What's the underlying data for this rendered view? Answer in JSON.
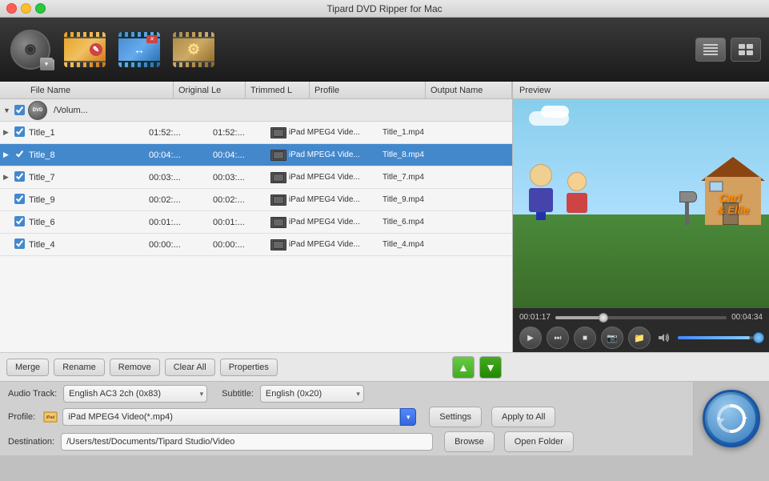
{
  "window": {
    "title": "Tipard DVD Ripper for Mac",
    "buttons": {
      "close": "close",
      "minimize": "minimize",
      "maximize": "maximize"
    }
  },
  "toolbar": {
    "dvd_label": "DVD",
    "view_list_icon": "≡",
    "view_grid_icon": "☰"
  },
  "file_list": {
    "headers": {
      "filename": "File Name",
      "original": "Original Le",
      "trimmed": "Trimmed L",
      "profile": "Profile",
      "output": "Output Name"
    },
    "root": {
      "path": "/Volum..."
    },
    "rows": [
      {
        "name": "Title_1",
        "original": "01:52:...",
        "trimmed": "01:52:...",
        "profile": "iPad MPEG4 Vide...",
        "output": "Title_1.mp4",
        "selected": false,
        "expanded": false
      },
      {
        "name": "Title_8",
        "original": "00:04:...",
        "trimmed": "00:04:...",
        "profile": "iPad MPEG4 Vide...",
        "output": "Title_8.mp4",
        "selected": true,
        "expanded": false
      },
      {
        "name": "Title_7",
        "original": "00:03:...",
        "trimmed": "00:03:...",
        "profile": "iPad MPEG4 Vide...",
        "output": "Title_7.mp4",
        "selected": false,
        "expanded": false
      },
      {
        "name": "Title_9",
        "original": "00:02:...",
        "trimmed": "00:02:...",
        "profile": "iPad MPEG4 Vide...",
        "output": "Title_9.mp4",
        "selected": false,
        "expanded": false
      },
      {
        "name": "Title_6",
        "original": "00:01:...",
        "trimmed": "00:01:...",
        "profile": "iPad MPEG4 Vide...",
        "output": "Title_6.mp4",
        "selected": false,
        "expanded": false
      },
      {
        "name": "Title_4",
        "original": "00:00:...",
        "trimmed": "00:00:...",
        "profile": "iPad MPEG4 Vide...",
        "output": "Title_4.mp4",
        "selected": false,
        "expanded": false
      }
    ]
  },
  "buttons": {
    "merge": "Merge",
    "rename": "Rename",
    "remove": "Remove",
    "clear_all": "Clear All",
    "properties": "Properties",
    "settings": "Settings",
    "apply_to_all": "Apply to All",
    "browse": "Browse",
    "open_folder": "Open Folder"
  },
  "preview": {
    "title": "Preview",
    "time_current": "00:01:17",
    "time_total": "00:04:34",
    "progress_pct": 28
  },
  "player_controls": {
    "play": "▶",
    "forward": "⏭",
    "stop": "■",
    "screenshot": "📷",
    "folder": "📁"
  },
  "settings": {
    "audio_track_label": "Audio Track:",
    "audio_track_value": "English AC3 2ch (0x83)",
    "subtitle_label": "Subtitle:",
    "subtitle_value": "English (0x20)",
    "profile_label": "Profile:",
    "profile_value": "iPad MPEG4 Video(*.mp4)",
    "destination_label": "Destination:",
    "destination_value": "/Users/test/Documents/Tipard Studio/Video"
  },
  "scene": {
    "carl_text": "Carl",
    "ellie_text": "& Ellie"
  }
}
